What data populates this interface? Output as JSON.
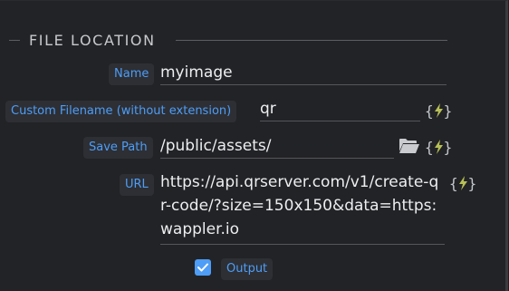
{
  "section": {
    "title": "FILE LOCATION"
  },
  "fields": {
    "name": {
      "label": "Name",
      "value": "myimage"
    },
    "custom_filename": {
      "label": "Custom Filename (without extension)",
      "value": "qr"
    },
    "save_path": {
      "label": "Save Path",
      "value": "/public/assets/"
    },
    "url": {
      "label": "URL",
      "value": "https://api.qrserver.com/v1/create-qr-code/?size=150x150&data=https:wappler.io"
    }
  },
  "output": {
    "label": "Output",
    "checked": true
  },
  "icons": {
    "dynamic": "lightning-bolt-icon",
    "folder": "folder-open-icon",
    "check": "checkmark-icon"
  },
  "colors": {
    "background": "#222326",
    "label_text": "#4e9df7",
    "label_bg": "#2d2f34",
    "value_text": "#eceef0",
    "bolt": "#b7bf57"
  }
}
